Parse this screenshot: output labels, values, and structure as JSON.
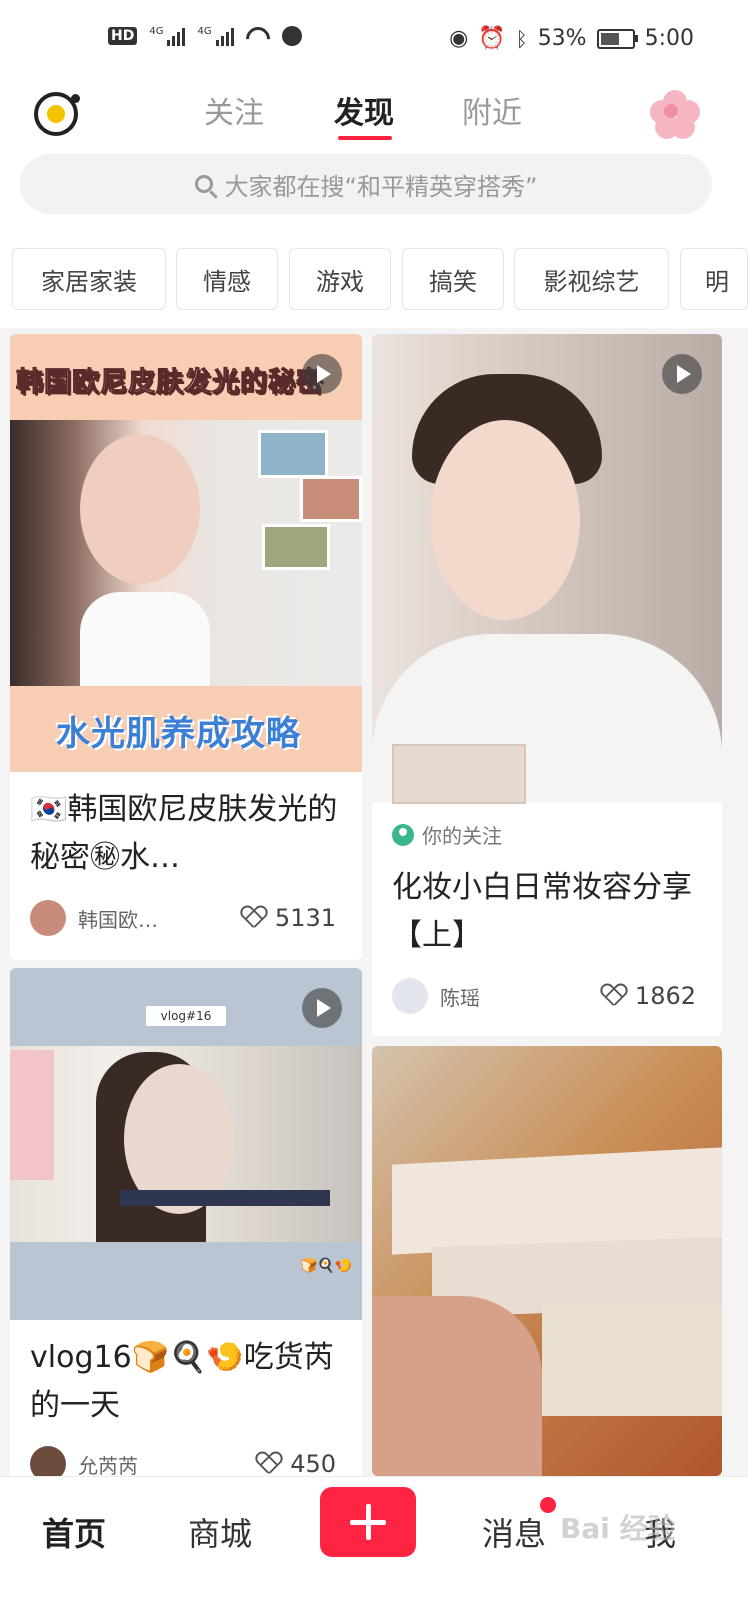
{
  "status_bar": {
    "network_left": "HD",
    "signal1": "4G",
    "signal2": "4G",
    "battery_percent": "53%",
    "time": "5:00"
  },
  "header": {
    "tabs": [
      {
        "label": "关注"
      },
      {
        "label": "发现"
      },
      {
        "label": "附近"
      }
    ],
    "active_tab": "发现",
    "search_placeholder": "大家都在搜“和平精英穿搭秀”"
  },
  "categories": [
    "家居家装",
    "情感",
    "游戏",
    "搞笑",
    "影视综艺",
    "明"
  ],
  "feed": [
    {
      "overlay_top": "韩国欧尼皮肤发光的秘密",
      "overlay_bottom": "水光肌养成攻略",
      "title": "🇰🇷韩国欧尼皮肤发光的秘密㊙水…",
      "author": "韩国欧…",
      "likes": "5131",
      "is_video": true
    },
    {
      "follow_tag": "你的关注",
      "title": "化妆小白日常妆容分享【上】",
      "author": "陈瑶",
      "likes": "1862",
      "is_video": true
    },
    {
      "overlay_top": "vlog#16",
      "title": "vlog16🍞🍳🍤吃货芮的一天",
      "author": "允芮芮",
      "likes": "450",
      "is_video": true
    },
    {
      "title": "",
      "is_video": false
    }
  ],
  "bottom_nav": {
    "home": "首页",
    "mall": "商城",
    "messages": "消息",
    "me": "我",
    "watermark": "Bai 经验"
  },
  "colors": {
    "accent": "#ff2442",
    "follow_green": "#3bb58c"
  }
}
